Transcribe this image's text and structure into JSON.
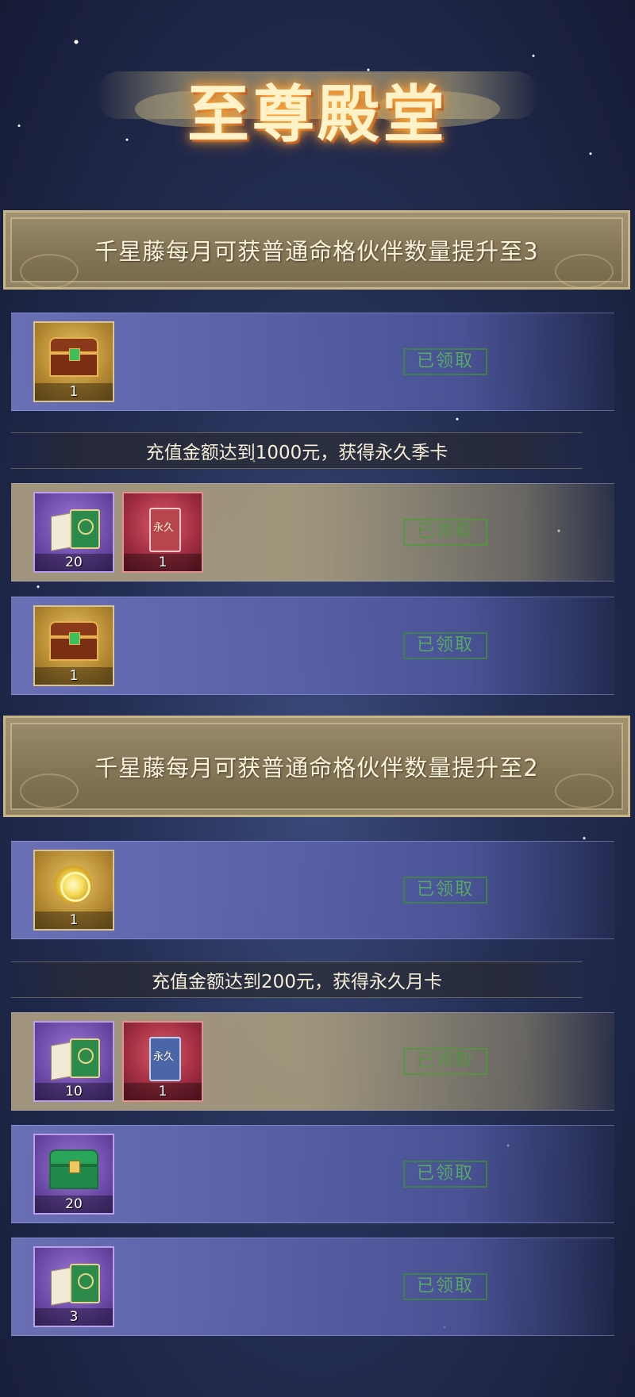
{
  "header": {
    "title": "至尊殿堂"
  },
  "sections": [
    {
      "banner": "千星藤每月可获普通命格伙伴数量提升至3",
      "rows": [
        {
          "items": [
            {
              "icon": "treasure-chest-icon",
              "count": "1"
            }
          ],
          "status": "已领取"
        },
        {
          "info": "充值金额达到1000元，获得永久季卡"
        },
        {
          "items": [
            {
              "icon": "skill-book-icon",
              "count": "20"
            },
            {
              "icon": "permanent-card-icon",
              "count": "1"
            }
          ],
          "status": "已领取"
        },
        {
          "items": [
            {
              "icon": "treasure-chest-icon",
              "count": "1"
            }
          ],
          "status": "已领取"
        }
      ]
    },
    {
      "banner": "千星藤每月可获普通命格伙伴数量提升至2",
      "rows": [
        {
          "items": [
            {
              "icon": "golden-orb-icon",
              "count": "1"
            }
          ],
          "status": "已领取"
        },
        {
          "info": "充值金额达到200元，获得永久月卡"
        },
        {
          "items": [
            {
              "icon": "skill-book-icon",
              "count": "10"
            },
            {
              "icon": "permanent-card-icon",
              "count": "1"
            }
          ],
          "status": "已领取"
        },
        {
          "items": [
            {
              "icon": "green-chest-icon",
              "count": "20"
            }
          ],
          "status": "已领取"
        },
        {
          "items": [
            {
              "icon": "skill-book-icon",
              "count": "3"
            }
          ],
          "status": "已领取"
        }
      ]
    }
  ],
  "card_glyph": "永久"
}
